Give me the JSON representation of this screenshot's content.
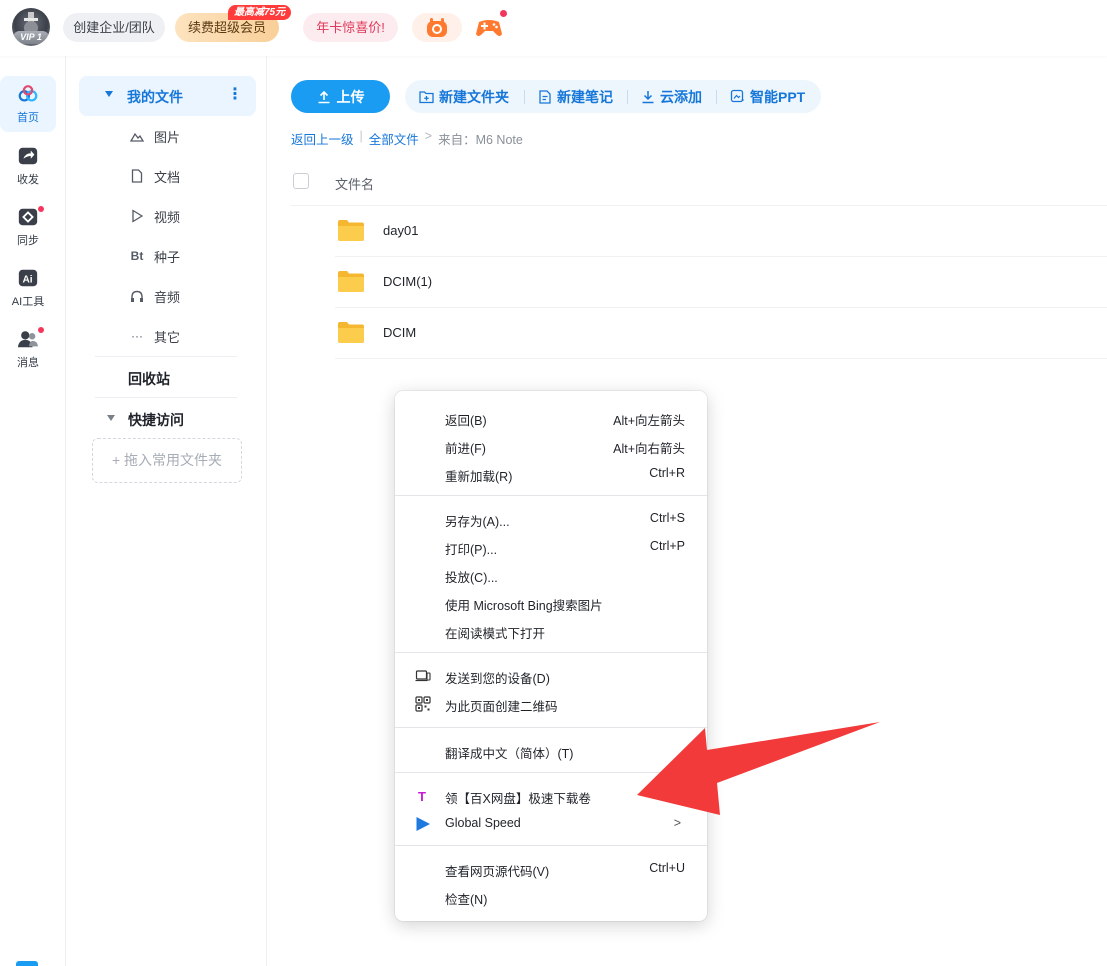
{
  "topbar": {
    "vip_label": "VIP 1",
    "team_label": "创建企业/团队",
    "renew_label": "续费超级会员",
    "promo_badge": "最高减75元",
    "year_card_label": "年卡惊喜价!"
  },
  "rail": {
    "items": [
      {
        "label": "首页",
        "icon": "home-cloud-icon",
        "active": true
      },
      {
        "label": "收发",
        "icon": "share-icon"
      },
      {
        "label": "同步",
        "icon": "sync-icon",
        "dot": true
      },
      {
        "label": "AI工具",
        "icon": "ai-icon"
      },
      {
        "label": "消息",
        "icon": "message-icon",
        "dot": true
      }
    ]
  },
  "tree": {
    "my_files": "我的文件",
    "sub_items": [
      {
        "label": "图片",
        "icon": "image-icon"
      },
      {
        "label": "文档",
        "icon": "document-icon"
      },
      {
        "label": "视频",
        "icon": "video-icon"
      },
      {
        "label": "种子",
        "icon": "bt-icon"
      },
      {
        "label": "音频",
        "icon": "audio-icon"
      },
      {
        "label": "其它",
        "icon": "more-icon"
      }
    ],
    "recycle": "回收站",
    "quick_access": "快捷访问",
    "drop_zone": "+ 拖入常用文件夹"
  },
  "toolbar": {
    "upload": "上传",
    "new_folder": "新建文件夹",
    "new_note": "新建笔记",
    "cloud_add": "云添加",
    "smart_ppt": "智能PPT"
  },
  "breadcrumb": {
    "back": "返回上一级",
    "sep": "|",
    "all_files": "全部文件",
    "arrow": ">",
    "from": "来自：M6 Note"
  },
  "file_list": {
    "column_name": "文件名",
    "rows": [
      {
        "name": "day01"
      },
      {
        "name": "DCIM(1)"
      },
      {
        "name": "DCIM"
      }
    ]
  },
  "context_menu": {
    "items": [
      {
        "label": "返回(B)",
        "shortcut": "Alt+向左箭头"
      },
      {
        "label": "前进(F)",
        "shortcut": "Alt+向右箭头"
      },
      {
        "label": "重新加载(R)",
        "shortcut": "Ctrl+R"
      },
      {
        "label": "另存为(A)...",
        "shortcut": "Ctrl+S"
      },
      {
        "label": "打印(P)...",
        "shortcut": "Ctrl+P"
      },
      {
        "label": "投放(C)...",
        "shortcut": ""
      },
      {
        "label": "使用 Microsoft Bing搜索图片",
        "shortcut": ""
      },
      {
        "label": "在阅读模式下打开",
        "shortcut": ""
      },
      {
        "label": "发送到您的设备(D)",
        "shortcut": "",
        "icon": "device-icon"
      },
      {
        "label": "为此页面创建二维码",
        "shortcut": "",
        "icon": "qrcode-icon"
      },
      {
        "label": "翻译成中文（简体）(T)",
        "shortcut": ""
      },
      {
        "label": "领【百X网盘】极速下载卷",
        "shortcut": "",
        "icon": "t-extension-icon"
      },
      {
        "label": "Global Speed",
        "shortcut": ">",
        "icon": "play-triangle-icon"
      },
      {
        "label": "查看网页源代码(V)",
        "shortcut": "Ctrl+U"
      },
      {
        "label": "检查(N)",
        "shortcut": ""
      }
    ]
  },
  "colors": {
    "accent": "#1a9cf2",
    "link": "#1677d9",
    "arrow": "#f23a3a",
    "folder": "#f7c446"
  }
}
